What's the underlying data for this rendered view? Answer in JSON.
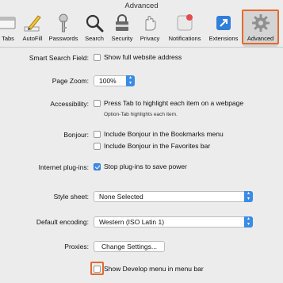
{
  "window": {
    "title": "Advanced"
  },
  "toolbar": {
    "items": [
      {
        "label": "Tabs",
        "icon": "tabs-icon"
      },
      {
        "label": "AutoFill",
        "icon": "pencil-icon"
      },
      {
        "label": "Passwords",
        "icon": "key-icon"
      },
      {
        "label": "Search",
        "icon": "magnifier-icon"
      },
      {
        "label": "Security",
        "icon": "lock-icon"
      },
      {
        "label": "Privacy",
        "icon": "hand-icon"
      },
      {
        "label": "Notifications",
        "icon": "notifications-icon"
      },
      {
        "label": "Extensions",
        "icon": "puzzle-icon"
      },
      {
        "label": "Advanced",
        "icon": "gear-icon",
        "selected": true
      }
    ]
  },
  "settings": {
    "smart_search": {
      "label": "Smart Search Field:",
      "checkbox": "Show full website address",
      "checked": false
    },
    "page_zoom": {
      "label": "Page Zoom:",
      "value": "100%"
    },
    "accessibility": {
      "label": "Accessibility:",
      "checkbox": "Press Tab to highlight each item on a webpage",
      "hint": "Option-Tab highlights each item.",
      "checked": false
    },
    "bonjour": {
      "label": "Bonjour:",
      "checkbox1": "Include Bonjour in the Bookmarks menu",
      "checkbox2": "Include Bonjour in the Favorites bar"
    },
    "plugins": {
      "label": "Internet plug-ins:",
      "checkbox": "Stop plug-ins to save power",
      "checked": true
    },
    "style_sheet": {
      "label": "Style sheet:",
      "value": "None Selected"
    },
    "encoding": {
      "label": "Default encoding:",
      "value": "Western (ISO Latin 1)"
    },
    "proxies": {
      "label": "Proxies:",
      "button": "Change Settings..."
    },
    "develop": {
      "checkbox": "Show Develop menu in menu bar",
      "checked": false
    }
  },
  "colors": {
    "highlight": "#e5692f",
    "accent": "#3a8ce5"
  }
}
